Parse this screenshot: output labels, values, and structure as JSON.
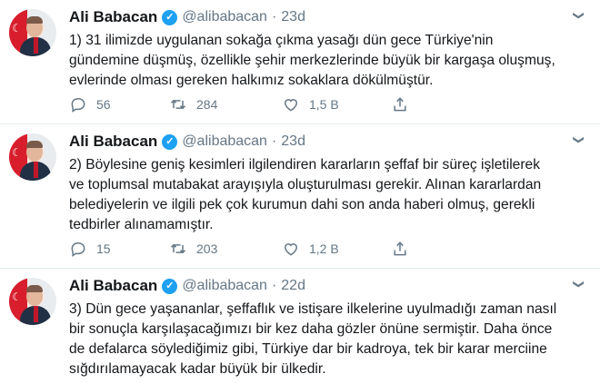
{
  "tweets": [
    {
      "name": "Ali Babacan",
      "handle": "@alibabacan",
      "separator": "·",
      "time": "23d",
      "text": "1) 31 ilimizde uygulanan sokağa çıkma yasağı dün gece Türkiye'nin\ngündemine düşmüş, özellikle şehir merkezlerinde büyük bir kargaşa oluşmuş,\nevlerinde olması gereken halkımız sokaklara dökülmüştür.",
      "replies": "56",
      "retweets": "284",
      "likes": "1,5 B"
    },
    {
      "name": "Ali Babacan",
      "handle": "@alibabacan",
      "separator": "·",
      "time": "23d",
      "text": "2) Böylesine geniş kesimleri ilgilendiren kararların şeffaf bir süreç işletilerek\nve toplumsal mutabakat arayışıyla oluşturulması gerekir. Alınan kararlardan\nbelediyelerin ve ilgili pek çok kurumun dahi son anda haberi olmuş, gerekli\ntedbirler alınamamıştır.",
      "replies": "15",
      "retweets": "203",
      "likes": "1,2 B"
    },
    {
      "name": "Ali Babacan",
      "handle": "@alibabacan",
      "separator": "·",
      "time": "22d",
      "text": "3) Dün gece yaşananlar, şeffaflık ve istişare ilkelerine uyulmadığı zaman nasıl\nbir sonuçla karşılaşacağımızı bir kez daha gözler önüne sermiştir. Daha önce\nde defalarca söylediğimiz gibi, Türkiye dar bir kadroya, tek bir karar merciine\nsığdırılamayacak kadar büyük bir ülkedir."
    }
  ],
  "icons": {
    "verified": "verified-badge-icon",
    "more": "chevron-down-icon",
    "reply": "reply-icon",
    "retweet": "retweet-icon",
    "like": "heart-icon",
    "share": "share-icon"
  },
  "colors": {
    "verified": "#1da1f2",
    "secondary_text": "#657786"
  }
}
